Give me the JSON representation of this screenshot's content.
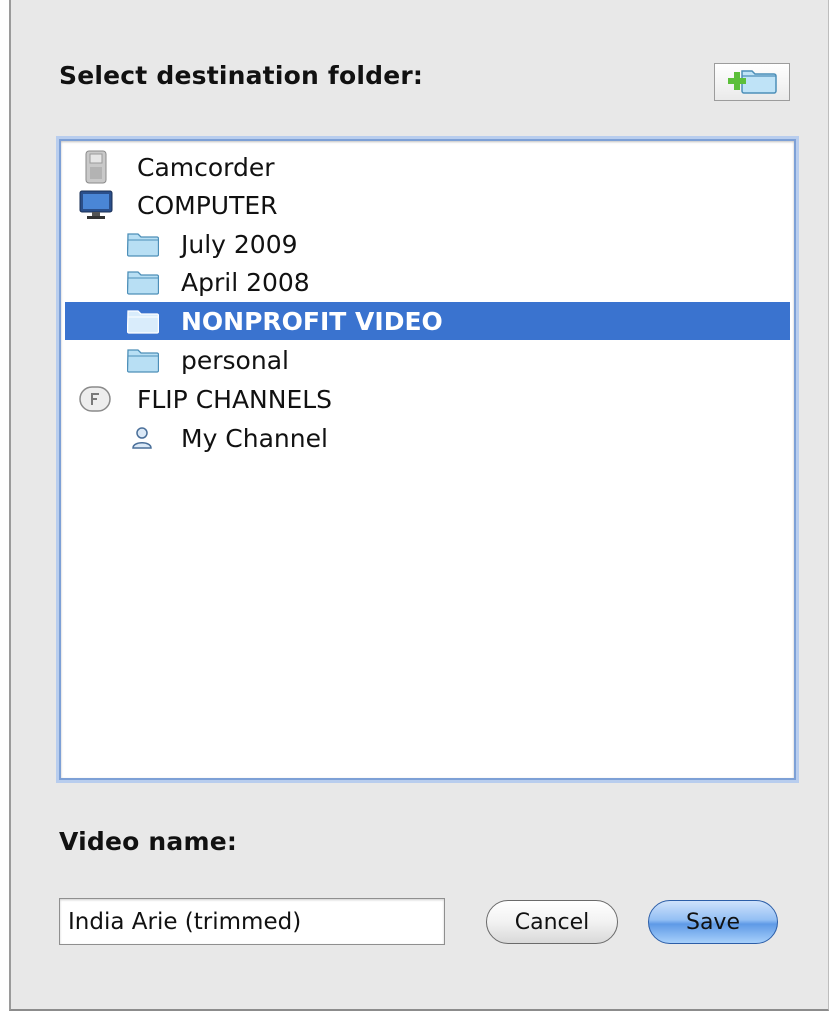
{
  "dialog": {
    "folder_heading": "Select destination folder:",
    "video_heading": "Video name:",
    "new_folder_icon": "new-folder-icon"
  },
  "tree": {
    "items": [
      {
        "label": "Camcorder",
        "icon": "camcorder-icon",
        "level": 0,
        "selected": false
      },
      {
        "label": "COMPUTER",
        "icon": "computer-icon",
        "level": 0,
        "selected": false
      },
      {
        "label": "July 2009",
        "icon": "folder-icon",
        "level": 1,
        "selected": false
      },
      {
        "label": "April 2008",
        "icon": "folder-icon",
        "level": 1,
        "selected": false
      },
      {
        "label": "NONPROFIT VIDEO",
        "icon": "folder-icon",
        "level": 1,
        "selected": true
      },
      {
        "label": "personal",
        "icon": "folder-icon",
        "level": 1,
        "selected": false
      },
      {
        "label": "FLIP CHANNELS",
        "icon": "flip-channels-icon",
        "level": 0,
        "selected": false
      },
      {
        "label": "My Channel",
        "icon": "person-icon",
        "level": 1,
        "selected": false
      }
    ]
  },
  "form": {
    "video_name_value": "India Arie (trimmed)",
    "cancel_label": "Cancel",
    "save_label": "Save"
  },
  "colors": {
    "selection": "#3a73cf",
    "save_button": "#7fb2f0",
    "dialog_bg": "#e8e8e8"
  }
}
